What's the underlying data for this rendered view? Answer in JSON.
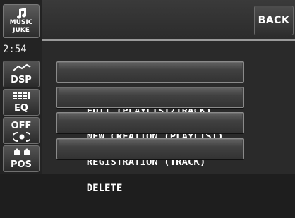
{
  "sidebar": {
    "logo": {
      "line1": "MUSIC",
      "line2": "JUKE"
    },
    "clock": "2:54",
    "buttons": [
      {
        "label": "DSP",
        "icon": "dsp-icon"
      },
      {
        "label": "EQ",
        "icon": "equalizer-icon"
      },
      {
        "label": "OFF",
        "icon": "surround-icon"
      },
      {
        "label": "POS",
        "icon": "speaker-position-icon"
      }
    ]
  },
  "header": {
    "back_label": "BACK"
  },
  "menu": {
    "items": [
      {
        "label": "EDIT (PLAYLIST/TRACK)"
      },
      {
        "label": "NEW CREATION (PLAYLIST)"
      },
      {
        "label": "REGISTRATION (TRACK)"
      },
      {
        "label": "DELETE"
      }
    ]
  },
  "colors": {
    "background": "#2a2a2a",
    "button_border": "#8a8a8a",
    "text": "#ffffff"
  }
}
